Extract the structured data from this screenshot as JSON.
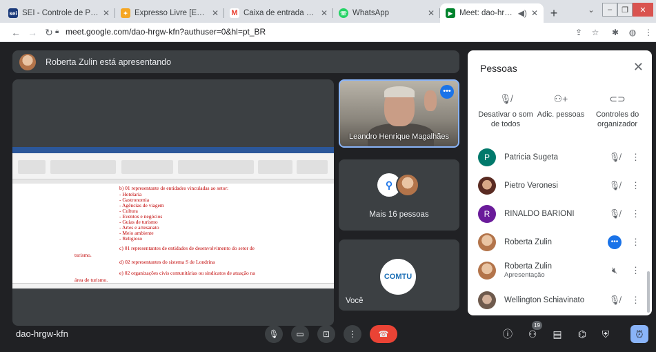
{
  "browser": {
    "tabs": [
      {
        "title": "SEI - Controle de Processos",
        "favicon": "sei-icon",
        "color": "#1b3a7a"
      },
      {
        "title": "Expresso Livre [Expresso M",
        "favicon": "expresso-icon",
        "color": "#f5a623"
      },
      {
        "title": "Caixa de entrada - comturl",
        "favicon": "gmail-icon",
        "color": "#ea4335"
      },
      {
        "title": "WhatsApp",
        "favicon": "whatsapp-icon",
        "color": "#25d366"
      },
      {
        "title": "Meet: dao-hrgw-kfn",
        "favicon": "meet-icon",
        "color": "#00832d"
      }
    ],
    "url": "meet.google.com/dao-hrgw-kfn?authuser=0&hl=pt_BR"
  },
  "meet": {
    "presenting_text": "Roberta Zulin está apresentando",
    "video_tile_name": "Leandro Henrique Magalhães",
    "group_tile_label": "Mais 16 pessoas",
    "you_label": "Você",
    "you_avatar_text": "COMTU",
    "meeting_code": "dao-hrgw-kfn",
    "people_count": "19"
  },
  "document": {
    "lines": [
      "b) 01 representante de entidades vinculadas ao setor:",
      "- Hotelaria",
      "- Gastronomia",
      "- Agências de viagem",
      "- Cultura",
      "- Eventos e negócios",
      "- Guias de turismo",
      "- Artes e artesanato",
      "- Meio ambiente",
      "- Religioso",
      "c) 01 representantes de entidades de desenvolvimento do setor de",
      "turismo.",
      "d) 02 representantes do sistema S de Londrina",
      "e) 02 organizações civis comunitárias ou sindicatos de atuação na",
      "área de turismo."
    ]
  },
  "panel": {
    "title": "Pessoas",
    "actions": [
      {
        "label": "Desativar o som de todos",
        "icon": "mic-off-icon"
      },
      {
        "label": "Adic. pessoas",
        "icon": "add-person-icon"
      },
      {
        "label": "Controles do organizador",
        "icon": "toggle-icon"
      }
    ],
    "people": [
      {
        "name": "Patricia Sugeta",
        "sub": "",
        "initial": "P",
        "color": "#00796b"
      },
      {
        "name": "Pietro Veronesi",
        "sub": "",
        "initial": "",
        "color": "#7a3b2e"
      },
      {
        "name": "RINALDO BARIONI",
        "sub": "",
        "initial": "R",
        "color": "#6a1b9a"
      },
      {
        "name": "Roberta Zulin",
        "sub": "",
        "initial": "",
        "color": "#b3744a"
      },
      {
        "name": "Roberta Zulin",
        "sub": "Apresentação",
        "initial": "",
        "color": "#b3744a"
      },
      {
        "name": "Wellington Schiavinato",
        "sub": "",
        "initial": "",
        "color": "#8a6d5a"
      }
    ]
  }
}
